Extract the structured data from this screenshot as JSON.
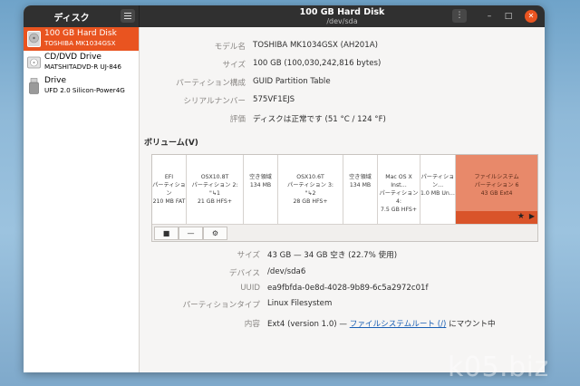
{
  "app": {
    "title": "ディスク",
    "window_title": "100 GB Hard Disk",
    "window_subtitle": "/dev/sda"
  },
  "sidebar": {
    "drives": [
      {
        "name": "100 GB Hard Disk",
        "sub": "TOSHIBA MK1034GSX",
        "icon": "hard-disk-icon",
        "selected": true
      },
      {
        "name": "CD/DVD Drive",
        "sub": "MATSHITADVD-R   UJ-846",
        "icon": "optical-drive-icon",
        "selected": false
      },
      {
        "name": "Drive",
        "sub": "UFD 2.0 Silicon-Power4G",
        "icon": "usb-drive-icon",
        "selected": false
      }
    ]
  },
  "disk_info": [
    {
      "label": "モデル名",
      "value": "TOSHIBA MK1034GSX (AH201A)"
    },
    {
      "label": "サイズ",
      "value": "100 GB (100,030,242,816 bytes)"
    },
    {
      "label": "パーティション構成",
      "value": "GUID Partition Table"
    },
    {
      "label": "シリアルナンバー",
      "value": "575VF1EJS"
    },
    {
      "label": "評価",
      "value": "ディスクは正常です (51 °C / 124 °F)"
    }
  ],
  "volumes": {
    "title": "ボリューム(V)",
    "partitions": [
      {
        "lines": [
          "EFI",
          "パーティション",
          "210 MB FAT"
        ]
      },
      {
        "lines": [
          "OSX10.8T",
          "パーティション 2:",
          "\"↳1",
          "21 GB HFS+"
        ]
      },
      {
        "lines": [
          "空き領域",
          "134 MB"
        ]
      },
      {
        "lines": [
          "OSX10.6T",
          "パーティション 3:",
          "\"↳2",
          "28 GB HFS+"
        ]
      },
      {
        "lines": [
          "空き領域",
          "134 MB"
        ]
      },
      {
        "lines": [
          "Mac OS X Inst…",
          "パーティション 4:",
          "7.5 GB HFS+"
        ]
      },
      {
        "lines": [
          "パーティション…",
          "1.0 MB Un…"
        ]
      },
      {
        "lines": [
          "ファイルシステム",
          "パーティション 6",
          "43 GB Ext4"
        ],
        "selected": true
      }
    ],
    "toolbar": {
      "stop": "■",
      "remove": "—",
      "settings": "⚙"
    }
  },
  "volume_info": [
    {
      "label": "サイズ",
      "value": "43 GB — 34 GB 空き (22.7% 使用)"
    },
    {
      "label": "デバイス",
      "value": "/dev/sda6"
    },
    {
      "label": "UUID",
      "value": "ea9fbfda-0e8d-4028-9b89-6c5a2972c01f"
    },
    {
      "label": "パーティションタイプ",
      "value": "Linux Filesystem"
    }
  ],
  "contents": {
    "label": "内容",
    "prefix": "Ext4 (version 1.0) — ",
    "link": "ファイルシステムルート (/)",
    "suffix": " にマウント中"
  },
  "watermark": "k05.biz",
  "colors": {
    "accent": "#e95420",
    "partition_selected": "#e8896a",
    "link": "#1a5fb4"
  }
}
